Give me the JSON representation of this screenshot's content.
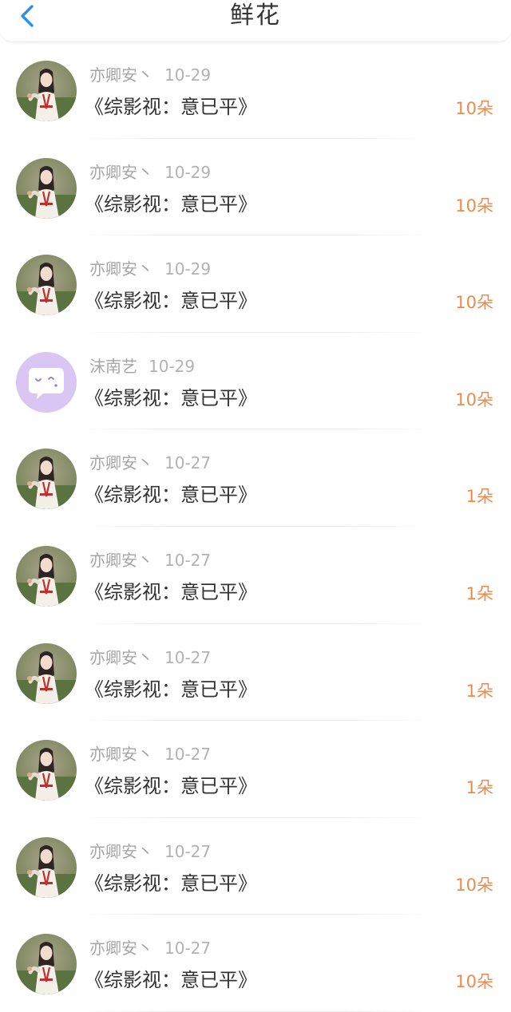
{
  "header": {
    "title": "鲜花",
    "back_icon": "chevron-left-icon",
    "accent_color": "#2f8ff0"
  },
  "colors": {
    "count": "#ec8b4c",
    "meta": "#a5a5a5",
    "title": "#333333"
  },
  "items": [
    {
      "user": "亦卿安丶",
      "date": "10-29",
      "book": "《综影视：意已平》",
      "count": "10朵",
      "avatar": "portrait"
    },
    {
      "user": "亦卿安丶",
      "date": "10-29",
      "book": "《综影视：意已平》",
      "count": "10朵",
      "avatar": "portrait"
    },
    {
      "user": "亦卿安丶",
      "date": "10-29",
      "book": "《综影视：意已平》",
      "count": "10朵",
      "avatar": "portrait"
    },
    {
      "user": "沫南艺",
      "date": "10-29",
      "book": "《综影视：意已平》",
      "count": "10朵",
      "avatar": "default-chat"
    },
    {
      "user": "亦卿安丶",
      "date": "10-27",
      "book": "《综影视：意已平》",
      "count": "1朵",
      "avatar": "portrait"
    },
    {
      "user": "亦卿安丶",
      "date": "10-27",
      "book": "《综影视：意已平》",
      "count": "1朵",
      "avatar": "portrait"
    },
    {
      "user": "亦卿安丶",
      "date": "10-27",
      "book": "《综影视：意已平》",
      "count": "1朵",
      "avatar": "portrait"
    },
    {
      "user": "亦卿安丶",
      "date": "10-27",
      "book": "《综影视：意已平》",
      "count": "1朵",
      "avatar": "portrait"
    },
    {
      "user": "亦卿安丶",
      "date": "10-27",
      "book": "《综影视：意已平》",
      "count": "10朵",
      "avatar": "portrait"
    },
    {
      "user": "亦卿安丶",
      "date": "10-27",
      "book": "《综影视：意已平》",
      "count": "10朵",
      "avatar": "portrait"
    }
  ]
}
